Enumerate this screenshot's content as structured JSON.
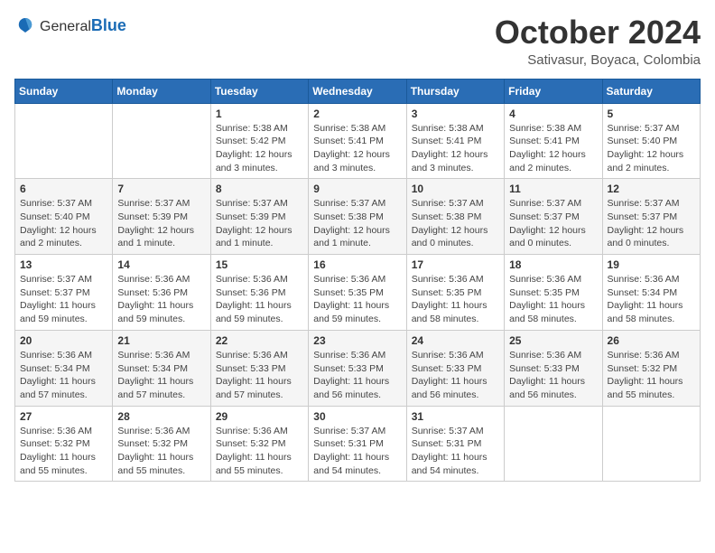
{
  "header": {
    "logo_general": "General",
    "logo_blue": "Blue",
    "month_title": "October 2024",
    "location": "Sativasur, Boyaca, Colombia"
  },
  "weekdays": [
    "Sunday",
    "Monday",
    "Tuesday",
    "Wednesday",
    "Thursday",
    "Friday",
    "Saturday"
  ],
  "weeks": [
    [
      {
        "day": "",
        "info": ""
      },
      {
        "day": "",
        "info": ""
      },
      {
        "day": "1",
        "info": "Sunrise: 5:38 AM\nSunset: 5:42 PM\nDaylight: 12 hours and 3 minutes."
      },
      {
        "day": "2",
        "info": "Sunrise: 5:38 AM\nSunset: 5:41 PM\nDaylight: 12 hours and 3 minutes."
      },
      {
        "day": "3",
        "info": "Sunrise: 5:38 AM\nSunset: 5:41 PM\nDaylight: 12 hours and 3 minutes."
      },
      {
        "day": "4",
        "info": "Sunrise: 5:38 AM\nSunset: 5:41 PM\nDaylight: 12 hours and 2 minutes."
      },
      {
        "day": "5",
        "info": "Sunrise: 5:37 AM\nSunset: 5:40 PM\nDaylight: 12 hours and 2 minutes."
      }
    ],
    [
      {
        "day": "6",
        "info": "Sunrise: 5:37 AM\nSunset: 5:40 PM\nDaylight: 12 hours and 2 minutes."
      },
      {
        "day": "7",
        "info": "Sunrise: 5:37 AM\nSunset: 5:39 PM\nDaylight: 12 hours and 1 minute."
      },
      {
        "day": "8",
        "info": "Sunrise: 5:37 AM\nSunset: 5:39 PM\nDaylight: 12 hours and 1 minute."
      },
      {
        "day": "9",
        "info": "Sunrise: 5:37 AM\nSunset: 5:38 PM\nDaylight: 12 hours and 1 minute."
      },
      {
        "day": "10",
        "info": "Sunrise: 5:37 AM\nSunset: 5:38 PM\nDaylight: 12 hours and 0 minutes."
      },
      {
        "day": "11",
        "info": "Sunrise: 5:37 AM\nSunset: 5:37 PM\nDaylight: 12 hours and 0 minutes."
      },
      {
        "day": "12",
        "info": "Sunrise: 5:37 AM\nSunset: 5:37 PM\nDaylight: 12 hours and 0 minutes."
      }
    ],
    [
      {
        "day": "13",
        "info": "Sunrise: 5:37 AM\nSunset: 5:37 PM\nDaylight: 11 hours and 59 minutes."
      },
      {
        "day": "14",
        "info": "Sunrise: 5:36 AM\nSunset: 5:36 PM\nDaylight: 11 hours and 59 minutes."
      },
      {
        "day": "15",
        "info": "Sunrise: 5:36 AM\nSunset: 5:36 PM\nDaylight: 11 hours and 59 minutes."
      },
      {
        "day": "16",
        "info": "Sunrise: 5:36 AM\nSunset: 5:35 PM\nDaylight: 11 hours and 59 minutes."
      },
      {
        "day": "17",
        "info": "Sunrise: 5:36 AM\nSunset: 5:35 PM\nDaylight: 11 hours and 58 minutes."
      },
      {
        "day": "18",
        "info": "Sunrise: 5:36 AM\nSunset: 5:35 PM\nDaylight: 11 hours and 58 minutes."
      },
      {
        "day": "19",
        "info": "Sunrise: 5:36 AM\nSunset: 5:34 PM\nDaylight: 11 hours and 58 minutes."
      }
    ],
    [
      {
        "day": "20",
        "info": "Sunrise: 5:36 AM\nSunset: 5:34 PM\nDaylight: 11 hours and 57 minutes."
      },
      {
        "day": "21",
        "info": "Sunrise: 5:36 AM\nSunset: 5:34 PM\nDaylight: 11 hours and 57 minutes."
      },
      {
        "day": "22",
        "info": "Sunrise: 5:36 AM\nSunset: 5:33 PM\nDaylight: 11 hours and 57 minutes."
      },
      {
        "day": "23",
        "info": "Sunrise: 5:36 AM\nSunset: 5:33 PM\nDaylight: 11 hours and 56 minutes."
      },
      {
        "day": "24",
        "info": "Sunrise: 5:36 AM\nSunset: 5:33 PM\nDaylight: 11 hours and 56 minutes."
      },
      {
        "day": "25",
        "info": "Sunrise: 5:36 AM\nSunset: 5:33 PM\nDaylight: 11 hours and 56 minutes."
      },
      {
        "day": "26",
        "info": "Sunrise: 5:36 AM\nSunset: 5:32 PM\nDaylight: 11 hours and 55 minutes."
      }
    ],
    [
      {
        "day": "27",
        "info": "Sunrise: 5:36 AM\nSunset: 5:32 PM\nDaylight: 11 hours and 55 minutes."
      },
      {
        "day": "28",
        "info": "Sunrise: 5:36 AM\nSunset: 5:32 PM\nDaylight: 11 hours and 55 minutes."
      },
      {
        "day": "29",
        "info": "Sunrise: 5:36 AM\nSunset: 5:32 PM\nDaylight: 11 hours and 55 minutes."
      },
      {
        "day": "30",
        "info": "Sunrise: 5:37 AM\nSunset: 5:31 PM\nDaylight: 11 hours and 54 minutes."
      },
      {
        "day": "31",
        "info": "Sunrise: 5:37 AM\nSunset: 5:31 PM\nDaylight: 11 hours and 54 minutes."
      },
      {
        "day": "",
        "info": ""
      },
      {
        "day": "",
        "info": ""
      }
    ]
  ]
}
